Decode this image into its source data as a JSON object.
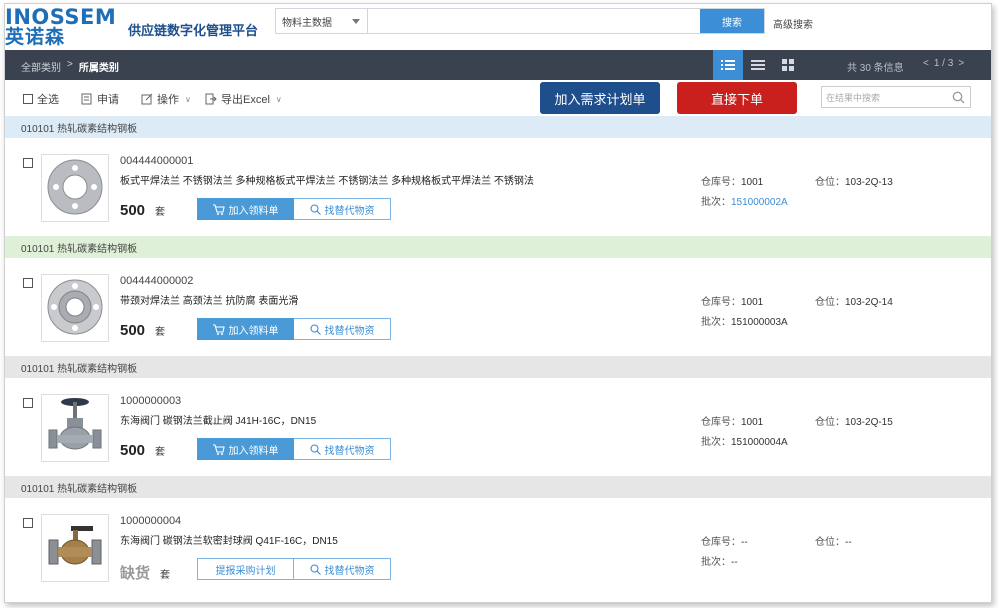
{
  "brand": {
    "logo_en": "INOSSEM",
    "logo_cn": "英诺森",
    "platform": "供应链数字化管理平台"
  },
  "search": {
    "category": "物料主数据",
    "value": "",
    "placeholder": "",
    "button": "搜索",
    "advanced": "高级搜索"
  },
  "nav": {
    "breadcrumb": [
      "全部类别",
      ">",
      "所属类别"
    ],
    "total": "共 30 条信息",
    "pager": {
      "prev": "<",
      "page": "1 / 3",
      "next": ">"
    }
  },
  "toolbar": {
    "select_all": "全选",
    "apply": "申请",
    "operate": "操作",
    "export": "导出Excel",
    "plan_button": "加入需求计划单",
    "order_button": "直接下单",
    "result_search_placeholder": "在结果中搜索"
  },
  "items": [
    {
      "group": "010101 热轧碳素结构钢板",
      "code": "004444000001",
      "desc": "板式平焊法兰 不锈钢法兰 多种规格板式平焊法兰 不锈钢法兰 多种规格板式平焊法兰 不锈钢法",
      "qty": "500",
      "unit": "套",
      "action1": "加入领料单",
      "action2": "找替代物资",
      "warehouse_label": "仓库号：",
      "warehouse": "1001",
      "batch_label": "批次：",
      "batch": "151000002A",
      "location_label": "仓位：",
      "location": "103-2Q-13",
      "icon": "flat-flange-image"
    },
    {
      "group": "010101 热轧碳素结构钢板",
      "code": "004444000002",
      "desc": "带颈对焊法兰 高颈法兰 抗防腐 表面光滑",
      "qty": "500",
      "unit": "套",
      "action1": "加入领料单",
      "action2": "找替代物资",
      "warehouse_label": "仓库号：",
      "warehouse": "1001",
      "batch_label": "批次：",
      "batch": "151000003A",
      "location_label": "仓位：",
      "location": "103-2Q-14",
      "icon": "neck-flange-image"
    },
    {
      "group": "010101 热轧碳素结构钢板",
      "code": "1000000003",
      "desc": "东海阀门 碳钢法兰截止阀 J41H-16C，DN15",
      "qty": "500",
      "unit": "套",
      "action1": "加入领料单",
      "action2": "找替代物资",
      "warehouse_label": "仓库号：",
      "warehouse": "1001",
      "batch_label": "批次：",
      "batch": "151000004A",
      "location_label": "仓位：",
      "location": "103-2Q-15",
      "icon": "globe-valve-image"
    },
    {
      "group": "010101 热轧碳素结构钢板",
      "code": "1000000004",
      "desc": "东海阀门 碳钢法兰软密封球阀 Q41F-16C，DN15",
      "qty": "缺货",
      "unit": "套",
      "action1": "提报采购计划",
      "action2": "找替代物资",
      "warehouse_label": "仓库号：",
      "warehouse": "--",
      "batch_label": "批次：",
      "batch": "--",
      "location_label": "仓位：",
      "location": "--",
      "icon": "ball-valve-image"
    }
  ],
  "colors": {
    "group_bg": [
      "#dcebf6",
      "#dff0d8",
      "#e6e6e6",
      "#e6e6e6"
    ],
    "accent": "#3c8fd6",
    "plan_button": "#1f4e8c",
    "order_button": "#c9201e",
    "navbar": "#3a4250"
  }
}
